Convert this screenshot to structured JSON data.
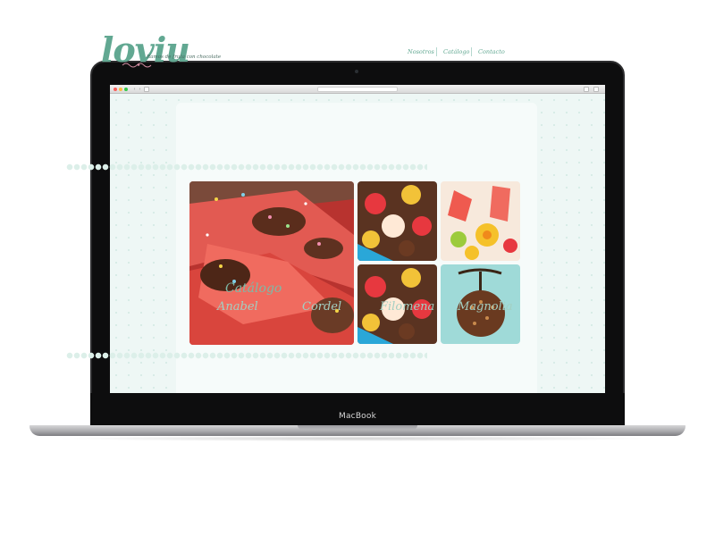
{
  "device": {
    "brand_label": "MacBook"
  },
  "browser": {
    "icons": [
      "close-dot",
      "minimize-dot",
      "zoom-dot",
      "back-icon",
      "forward-icon",
      "sidebar-icon",
      "share-icon",
      "tabs-icon"
    ]
  },
  "site": {
    "logo": "loviu",
    "tagline": "Ramos de fruta con chocolate",
    "nav": [
      "Nosotros",
      "Catálogo",
      "Contacto"
    ],
    "section_title": "Catálogo",
    "catalog_items": [
      "Anabel",
      "Cordel",
      "Filomena",
      "Magnolia"
    ]
  },
  "colors": {
    "accent": "#62a892",
    "page_bg": "#eef7f5",
    "panel_bg": "#f6fbfa"
  }
}
